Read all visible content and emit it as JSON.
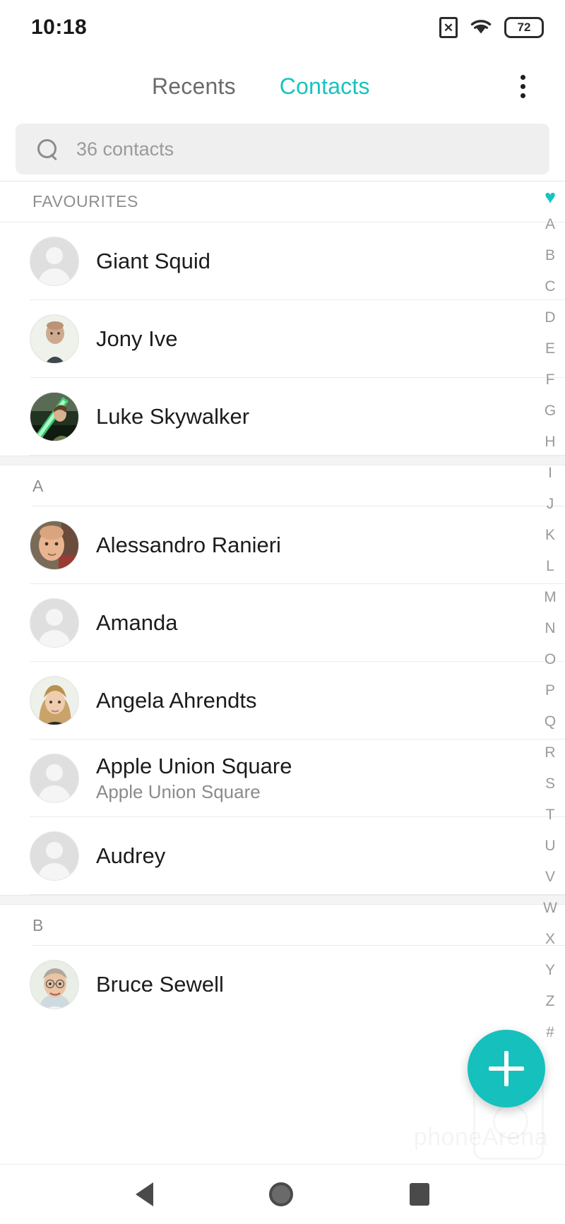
{
  "statusbar": {
    "time": "10:18",
    "sim_icon": "sim-card-x-icon",
    "sim_glyph": "✕",
    "wifi_icon": "wifi-icon",
    "battery_level": "72"
  },
  "header": {
    "tabs": [
      {
        "label": "Recents",
        "active": false
      },
      {
        "label": "Contacts",
        "active": true
      }
    ],
    "overflow_menu": "overflow-menu-icon",
    "accent_color": "#17c3c0"
  },
  "search": {
    "icon": "search-icon",
    "placeholder": "36 contacts",
    "value": ""
  },
  "favourites_header": "FAVOURITES",
  "sections": [
    {
      "label": "FAVOURITES",
      "kind": "favourites",
      "contacts": [
        {
          "name": "Giant Squid",
          "subtitle": "",
          "avatar": "placeholder"
        },
        {
          "name": "Jony Ive",
          "subtitle": "",
          "avatar": "photo-jony"
        },
        {
          "name": "Luke Skywalker",
          "subtitle": "",
          "avatar": "photo-luke"
        }
      ]
    },
    {
      "label": "A",
      "kind": "letter",
      "contacts": [
        {
          "name": "Alessandro Ranieri",
          "subtitle": "",
          "avatar": "photo-alessandro"
        },
        {
          "name": "Amanda",
          "subtitle": "",
          "avatar": "placeholder"
        },
        {
          "name": "Angela Ahrendts",
          "subtitle": "",
          "avatar": "photo-angela"
        },
        {
          "name": "Apple Union Square",
          "subtitle": "Apple Union Square",
          "avatar": "placeholder"
        },
        {
          "name": "Audrey",
          "subtitle": "",
          "avatar": "placeholder"
        }
      ]
    },
    {
      "label": "B",
      "kind": "letter",
      "contacts": [
        {
          "name": "Bruce Sewell",
          "subtitle": "",
          "avatar": "photo-bruce"
        }
      ]
    }
  ],
  "index": {
    "heart_icon": "heart-icon",
    "heart_glyph": "♥",
    "letters": [
      "A",
      "B",
      "C",
      "D",
      "E",
      "F",
      "G",
      "H",
      "I",
      "J",
      "K",
      "L",
      "M",
      "N",
      "O",
      "P",
      "Q",
      "R",
      "S",
      "T",
      "U",
      "V",
      "W",
      "X",
      "Y",
      "Z",
      "#"
    ]
  },
  "fab": {
    "icon": "plus-icon",
    "label": "Add contact",
    "color": "#16c0bd"
  },
  "watermark": "phoneArena",
  "navbar": {
    "back": "back-icon",
    "home": "home-icon",
    "recents": "recents-icon"
  }
}
